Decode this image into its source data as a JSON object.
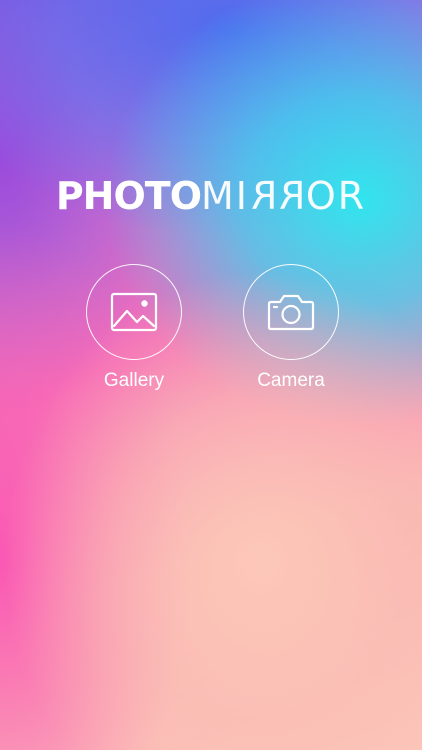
{
  "app": {
    "logo_bold": "PHOTO",
    "logo_light_prefix": "MI",
    "logo_light_mirrored_r1": "R",
    "logo_light_mirrored_r2": "R",
    "logo_light_suffix": "OR"
  },
  "actions": [
    {
      "label": "Gallery",
      "icon": "gallery-icon"
    },
    {
      "label": "Camera",
      "icon": "camera-icon"
    }
  ],
  "colors": {
    "foreground": "#ffffff",
    "gradient_blue": "#466ef0",
    "gradient_cyan": "#28ebf0",
    "gradient_pink": "#fa50b4",
    "gradient_peach": "#fcc8b8"
  }
}
